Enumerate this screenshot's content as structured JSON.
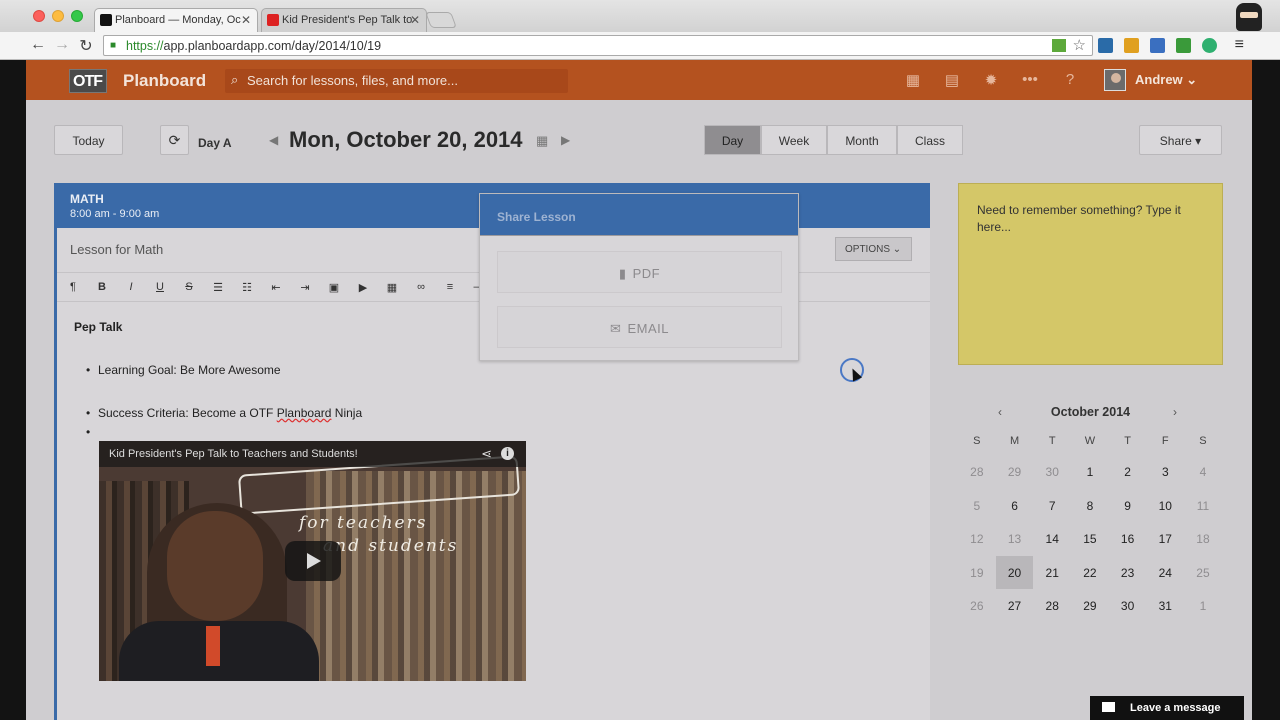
{
  "browser": {
    "tabs": [
      {
        "title": "Planboard — Monday, Oc",
        "close": "✕"
      },
      {
        "title": "Kid President's Pep Talk to",
        "close": "✕"
      }
    ],
    "url_scheme": "https://",
    "url_rest": "app.planboardapp.com/day/2014/10/19"
  },
  "app": {
    "brand_logo": "OTF",
    "brand": "Planboard",
    "search_placeholder": "Search for lessons, files, and more...",
    "user": "Andrew",
    "topbar_icons": [
      "calendar-icon",
      "book-icon",
      "gear-icon",
      "more-icon",
      "help-icon"
    ]
  },
  "controls": {
    "today": "Today",
    "day_label": "Day A",
    "date": "Mon, October 20, 2014",
    "views": [
      "Day",
      "Week",
      "Month",
      "Class"
    ],
    "selected_view": "Day",
    "share": "Share"
  },
  "lesson": {
    "subject": "MATH",
    "time": "8:00 am - 9:00 am",
    "title": "Lesson for Math",
    "options": "OPTIONS",
    "heading": "Pep Talk",
    "bullets": [
      "Learning Goal: Be More Awesome",
      "Success Criteria: Become a OTF ",
      "Planboard",
      " Ninja"
    ],
    "video": {
      "title": "Kid President's Pep Talk to Teachers and Students!",
      "handwriting_1": "for teachers",
      "handwriting_2": "and students"
    }
  },
  "modal": {
    "title": "Share Lesson",
    "pdf": "PDF",
    "email": "EMAIL"
  },
  "sticky": "Need to remember something? Type it here...",
  "calendar": {
    "month": "October 2014",
    "dow": [
      "S",
      "M",
      "T",
      "W",
      "T",
      "F",
      "S"
    ],
    "weeks": [
      [
        "28",
        "29",
        "30",
        "1",
        "2",
        "3",
        "4"
      ],
      [
        "5",
        "6",
        "7",
        "8",
        "9",
        "10",
        "11"
      ],
      [
        "12",
        "13",
        "14",
        "15",
        "16",
        "17",
        "18"
      ],
      [
        "19",
        "20",
        "21",
        "22",
        "23",
        "24",
        "25"
      ],
      [
        "26",
        "27",
        "28",
        "29",
        "30",
        "31",
        "1"
      ]
    ],
    "selected": "20"
  },
  "chat": "Leave a message"
}
